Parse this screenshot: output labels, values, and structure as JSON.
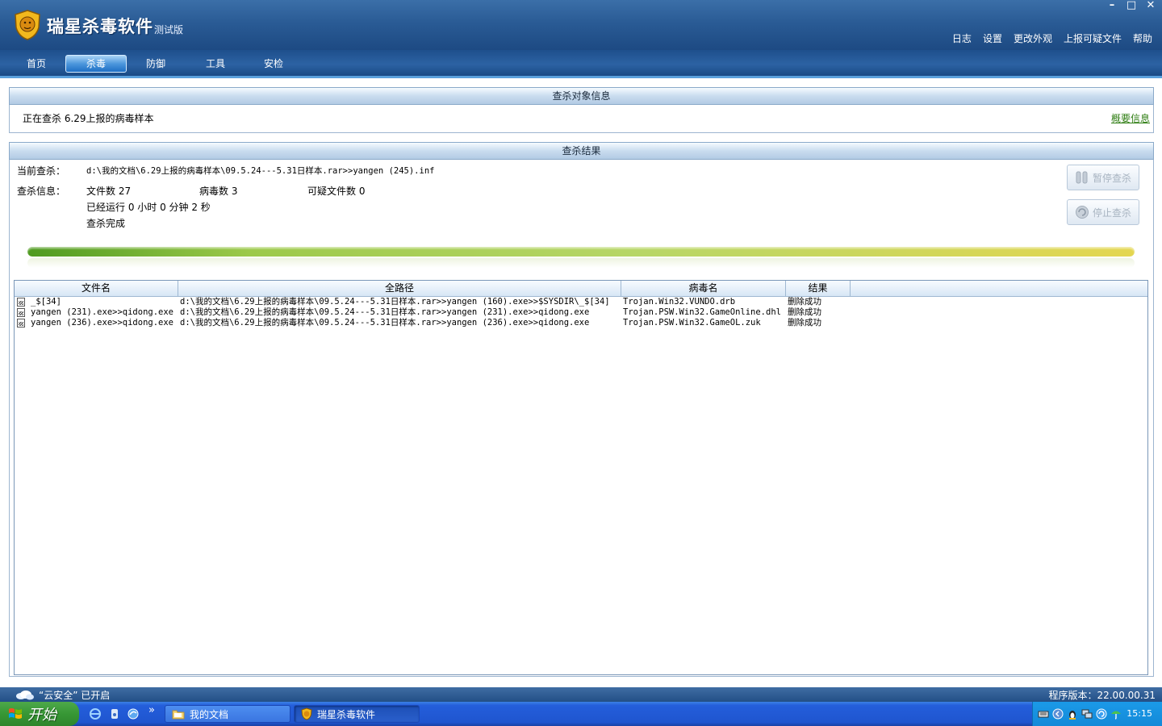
{
  "app": {
    "title": "瑞星杀毒软件",
    "title_suffix": "测试版",
    "window_controls": {
      "minimize": "–",
      "maximize": "□",
      "close": "✕"
    },
    "top_links": [
      "日志",
      "设置",
      "更改外观",
      "上报可疑文件",
      "帮助"
    ]
  },
  "tabs": [
    {
      "label": "首页",
      "active": false
    },
    {
      "label": "杀毒",
      "active": true
    },
    {
      "label": "防御",
      "active": false
    },
    {
      "label": "工具",
      "active": false
    },
    {
      "label": "安检",
      "active": false
    }
  ],
  "target_panel": {
    "header": "查杀对象信息",
    "text": "正在查杀 6.29上报的病毒样本",
    "summary_link": "概要信息"
  },
  "result_panel": {
    "header": "查杀结果",
    "current_label": "当前查杀：",
    "current_path": "d:\\我的文档\\6.29上报的病毒样本\\09.5.24---5.31日样本.rar>>yangen (245).inf",
    "info_label": "查杀信息：",
    "files_count": "文件数 27",
    "virus_count": "病毒数 3",
    "suspicious_count": "可疑文件数 0",
    "elapsed": "已经运行 0 小时 0 分钟 2  秒",
    "status": "查杀完成",
    "pause_button": "暂停查杀",
    "stop_button": "停止查杀",
    "progress": 1.0
  },
  "results_table": {
    "columns": [
      "文件名",
      "全路径",
      "病毒名",
      "结果"
    ],
    "rows": [
      {
        "file": "_$[34]",
        "path": "d:\\我的文档\\6.29上报的病毒样本\\09.5.24---5.31日样本.rar>>yangen (160).exe>>$SYSDIR\\_$[34]",
        "virus": "Trojan.Win32.VUNDO.drb",
        "result": "删除成功"
      },
      {
        "file": "yangen (231).exe>>qidong.exe",
        "path": "d:\\我的文档\\6.29上报的病毒样本\\09.5.24---5.31日样本.rar>>yangen (231).exe>>qidong.exe",
        "virus": "Trojan.PSW.Win32.GameOnline.dhl",
        "result": "删除成功"
      },
      {
        "file": "yangen (236).exe>>qidong.exe",
        "path": "d:\\我的文档\\6.29上报的病毒样本\\09.5.24---5.31日样本.rar>>yangen (236).exe>>qidong.exe",
        "virus": "Trojan.PSW.Win32.GameOL.zuk",
        "result": "删除成功"
      }
    ]
  },
  "statusbar": {
    "cloud_text": "“云安全” 已开启",
    "version": "程序版本：22.00.00.31"
  },
  "taskbar": {
    "start_label": "开始",
    "quicklaunch_more": "»",
    "tasks": [
      {
        "label": "我的文档",
        "active": false
      },
      {
        "label": "瑞星杀毒软件",
        "active": true
      }
    ],
    "clock": "15:15"
  },
  "colors": {
    "titlebar": "#2a5b95",
    "tab_active": "#4d97dc",
    "link_green": "#2e7d12",
    "progress": "#b7d666",
    "taskbar": "#245edb",
    "start_button": "#379735"
  }
}
